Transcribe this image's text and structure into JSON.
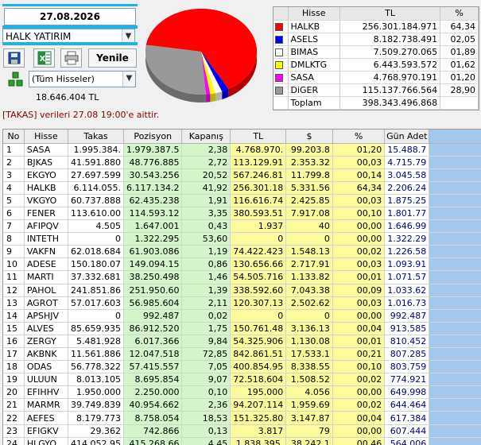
{
  "header": {
    "date": "27.08.2026",
    "firm": "HALK YATIRIM",
    "refresh_label": "Yenile",
    "stock_filter": "(Tüm Hisseler)",
    "total_tl": "18.646.404 TL",
    "notice": "[TAKAS] verileri 27.08 19:00'e aittir."
  },
  "colors": {
    "accent_highlight": "#19b4f0",
    "green_col": "#d3f5c7",
    "yellow_col": "#fbfb9c",
    "blue_fill": "#a3c8ee"
  },
  "summary": {
    "headers": [
      "Hisse",
      "TL",
      "%"
    ],
    "rows": [
      {
        "name": "HALKB",
        "tl": "256.301.184.971",
        "pct": "64,34",
        "color": "#ff0000"
      },
      {
        "name": "ASELS",
        "tl": "8.182.738.491",
        "pct": "02,05",
        "color": "#0000ff"
      },
      {
        "name": "BIMAS",
        "tl": "7.509.270.065",
        "pct": "01,89",
        "color": "#ffffff"
      },
      {
        "name": "DMLKTG",
        "tl": "6.443.593.572",
        "pct": "01,62",
        "color": "#ffff00"
      },
      {
        "name": "SASA",
        "tl": "4.768.970.191",
        "pct": "01,20",
        "color": "#ff00ff"
      },
      {
        "name": "DiGER",
        "tl": "115.137.766.564",
        "pct": "28,90",
        "color": "#999999"
      },
      {
        "name": "Toplam",
        "tl": "398.343.496.868",
        "pct": "",
        "color": ""
      }
    ]
  },
  "chart_data": {
    "type": "pie",
    "categories": [
      "HALKB",
      "ASELS",
      "BIMAS",
      "DMLKTG",
      "SASA",
      "DiGER"
    ],
    "values": [
      64.34,
      2.05,
      1.89,
      1.62,
      1.2,
      28.9
    ],
    "colors": [
      "#ff0000",
      "#0000ff",
      "#ffffff",
      "#ffff00",
      "#ff00ff",
      "#999999"
    ]
  },
  "grid": {
    "columns": [
      "No",
      "Hisse",
      "Takas",
      "Pozisyon",
      "Kapanış",
      "TL",
      "$",
      "%",
      "Gün Adet"
    ],
    "rows": [
      [
        "1",
        "SASA",
        "1.995.384.",
        "1.979.387.5",
        "2,38",
        "4.768.970.",
        "99.203.8",
        "01,20",
        "15.488.7"
      ],
      [
        "2",
        "BJKAS",
        "41.591.880",
        "48.776.885",
        "2,72",
        "113.129.91",
        "2.353.32",
        "00,03",
        "4.715.79"
      ],
      [
        "3",
        "EKGYO",
        "27.697.599",
        "30.543.256",
        "20,52",
        "567.246.81",
        "11.799.8",
        "00,14",
        "3.045.58"
      ],
      [
        "4",
        "HALKB",
        "6.114.055.",
        "6.117.134.2",
        "41,92",
        "256.301.18",
        "5.331.56",
        "64,34",
        "2.206.24"
      ],
      [
        "5",
        "VKGYO",
        "60.737.888",
        "62.435.238",
        "1,91",
        "116.616.74",
        "2.425.85",
        "00,03",
        "1.875.25"
      ],
      [
        "6",
        "FENER",
        "113.610.00",
        "114.593.12",
        "3,35",
        "380.593.51",
        "7.917.08",
        "00,10",
        "1.801.77"
      ],
      [
        "7",
        "AFIPQV",
        "4.505",
        "1.647.001",
        "0,43",
        "1.937",
        "40",
        "00,00",
        "1.646.99"
      ],
      [
        "8",
        "INTETH",
        "0",
        "1.322.295",
        "53,60",
        "0",
        "0",
        "00,00",
        "1.322.29"
      ],
      [
        "9",
        "VAKFN",
        "62.018.684",
        "61.903.086",
        "1,19",
        "74.422.423",
        "1.548.13",
        "00,02",
        "1.226.58"
      ],
      [
        "10",
        "ADESE",
        "150.180.07",
        "149.094.15",
        "0,86",
        "130.656.66",
        "2.717.91",
        "00,03",
        "1.093.91"
      ],
      [
        "11",
        "MARTI",
        "37.332.681",
        "38.250.498",
        "1,46",
        "54.505.716",
        "1.133.82",
        "00,01",
        "1.071.57"
      ],
      [
        "12",
        "PAHOL",
        "241.851.86",
        "251.950.60",
        "1,39",
        "338.592.60",
        "7.043.38",
        "00,09",
        "1.033.62"
      ],
      [
        "13",
        "AGROT",
        "57.017.603",
        "56.985.604",
        "2,11",
        "120.307.13",
        "2.502.62",
        "00,03",
        "1.016.73"
      ],
      [
        "14",
        "APSHJV",
        "0",
        "992.487",
        "0,02",
        "0",
        "0",
        "00,00",
        "992.487"
      ],
      [
        "15",
        "ALVES",
        "85.659.935",
        "86.912.520",
        "1,75",
        "150.761.48",
        "3.136.13",
        "00,04",
        "913.585"
      ],
      [
        "16",
        "ZERGY",
        "5.481.928",
        "6.017.366",
        "9,84",
        "54.325.906",
        "1.130.08",
        "00,01",
        "810.452"
      ],
      [
        "17",
        "AKBNK",
        "11.561.886",
        "12.047.518",
        "72,85",
        "842.861.51",
        "17.533.1",
        "00,21",
        "807.285"
      ],
      [
        "18",
        "ODAS",
        "56.778.322",
        "57.415.557",
        "7,05",
        "400.854.95",
        "8.338.55",
        "00,10",
        "803.759"
      ],
      [
        "19",
        "ULUUN",
        "8.013.105",
        "8.695.854",
        "9,07",
        "72.518.604",
        "1.508.52",
        "00,02",
        "774.921"
      ],
      [
        "20",
        "EFIHHV",
        "1.950.000",
        "2.250.000",
        "0,10",
        "195.000",
        "4.056",
        "00,00",
        "649.998"
      ],
      [
        "21",
        "MARMR",
        "39.749.839",
        "40.954.662",
        "2,36",
        "94.207.114",
        "1.959.69",
        "00,02",
        "644.464"
      ],
      [
        "22",
        "AEFES",
        "8.179.773",
        "8.758.054",
        "18,53",
        "151.325.80",
        "3.147.87",
        "00,04",
        "617.384"
      ],
      [
        "23",
        "EFIGKV",
        "29.362",
        "742.866",
        "0,13",
        "3.817",
        "79",
        "00,00",
        "607.444"
      ],
      [
        "24",
        "HLGYO",
        "414.052.95",
        "415.268.66",
        "4,45",
        "1.838.395.",
        "38.242.1",
        "00,46",
        "564.006"
      ],
      [
        "25",
        "ANILKV",
        "1.073.614",
        "1.680.753",
        "0,14",
        "150.306",
        "3.127",
        "00,00",
        "533.351"
      ]
    ]
  }
}
